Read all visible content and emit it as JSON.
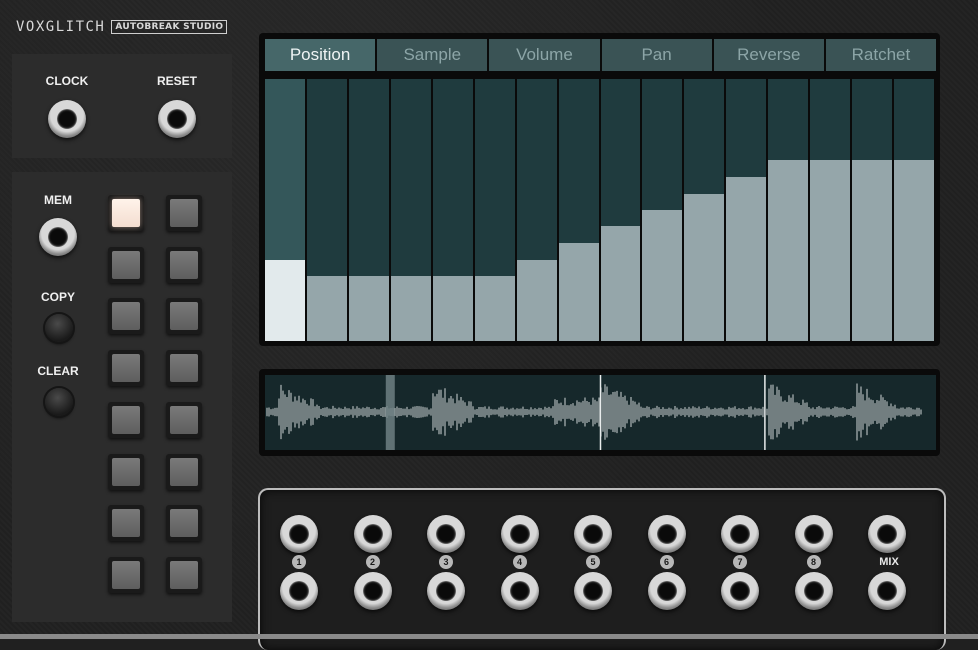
{
  "brand": {
    "name": "VOXGLITCH",
    "product": "AUTOBREAK STUDIO"
  },
  "clock_section": {
    "clock_label": "CLOCK",
    "reset_label": "RESET"
  },
  "memory_section": {
    "mem_label": "MEM",
    "copy_label": "COPY",
    "clear_label": "CLEAR",
    "pad_count": 16,
    "active_pad": 0
  },
  "sequencer": {
    "tabs": [
      "Position",
      "Sample",
      "Volume",
      "Pan",
      "Reverse",
      "Ratchet"
    ],
    "active_tab": 0,
    "active_step": 0,
    "steps": [
      0.31,
      0.25,
      0.25,
      0.25,
      0.25,
      0.25,
      0.31,
      0.375,
      0.44,
      0.5,
      0.56,
      0.625,
      0.69,
      0.69,
      0.69,
      0.69
    ],
    "colors": {
      "step_bg": "#1f3b3e",
      "step_active_bg": "#34575a",
      "fill": "#95a6aa",
      "fill_active": "#e2eaec",
      "tab": "#3a5355",
      "tab_active": "#466769"
    }
  },
  "waveform": {
    "playhead": 0.18
  },
  "outputs": {
    "labels": [
      "1",
      "2",
      "3",
      "4",
      "5",
      "6",
      "7",
      "8"
    ],
    "mix_label": "MIX"
  }
}
